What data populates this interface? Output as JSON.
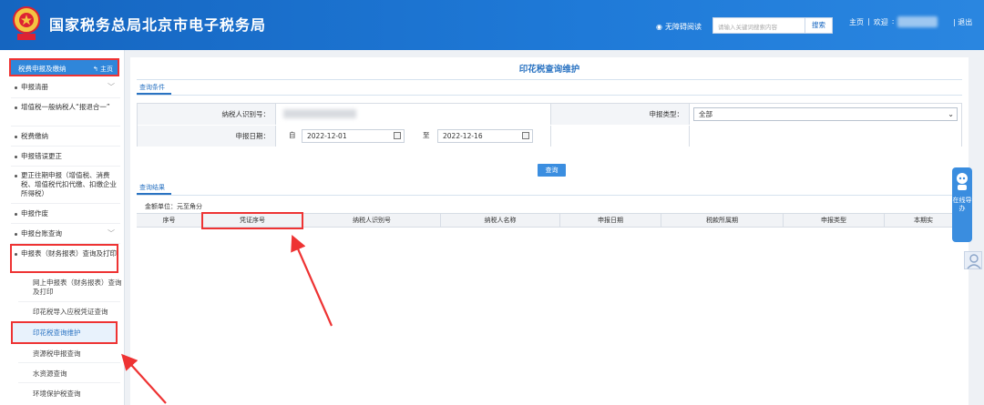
{
  "header": {
    "title": "国家税务总局北京市电子税务局",
    "accessible_reading": "无障碍阅读",
    "search_placeholder": "请输入关键词搜索内容",
    "search_button": "搜索",
    "home": "主页",
    "welcome": "欢迎",
    "exit": "退出"
  },
  "sidebar": {
    "header_label": "税费申报及缴纳",
    "home_label": "主页",
    "items": [
      {
        "label": "申报清册"
      },
      {
        "label": "增值税一般纳税人“报退合一”"
      },
      {
        "label": "税费缴纳"
      },
      {
        "label": "申报错误更正"
      },
      {
        "label": "更正往期申报（增值税、消费税、增值税代扣代缴、扣缴企业所得税）"
      },
      {
        "label": "申报作废"
      },
      {
        "label": "申报台账查询"
      },
      {
        "label": "申报表（财务报表）查询及打印"
      }
    ],
    "sub_items": [
      {
        "label": "网上申报表（财务报表）查询及打印"
      },
      {
        "label": "印花税导入应税凭证查询"
      },
      {
        "label": "印花税查询维护"
      },
      {
        "label": "资源税申报查询"
      },
      {
        "label": "水资源查询"
      },
      {
        "label": "环境保护税查询"
      }
    ]
  },
  "main": {
    "title": "印花税查询维护",
    "query_tab": "查询条件",
    "result_tab": "查询结果",
    "taxpayer_id_label": "纳税人识别号：",
    "declare_type_label": "申报类型：",
    "declare_type_value": "全部",
    "declare_date_label": "申报日期：",
    "from_label": "自",
    "to_label": "至",
    "date_from": "2022-12-01",
    "date_to": "2022-12-16",
    "query_button": "查询",
    "unit_text": "金额单位：元至角分",
    "columns": [
      "序号",
      "凭证序号",
      "纳税人识别号",
      "纳税人名称",
      "申报日期",
      "税款所属期",
      "申报类型",
      "本期实"
    ]
  },
  "float": {
    "help_text": "在线导办"
  },
  "colors": {
    "header_blue": "#1f7ad8",
    "highlight_red": "#e33333",
    "accent_blue": "#2a73c2"
  }
}
